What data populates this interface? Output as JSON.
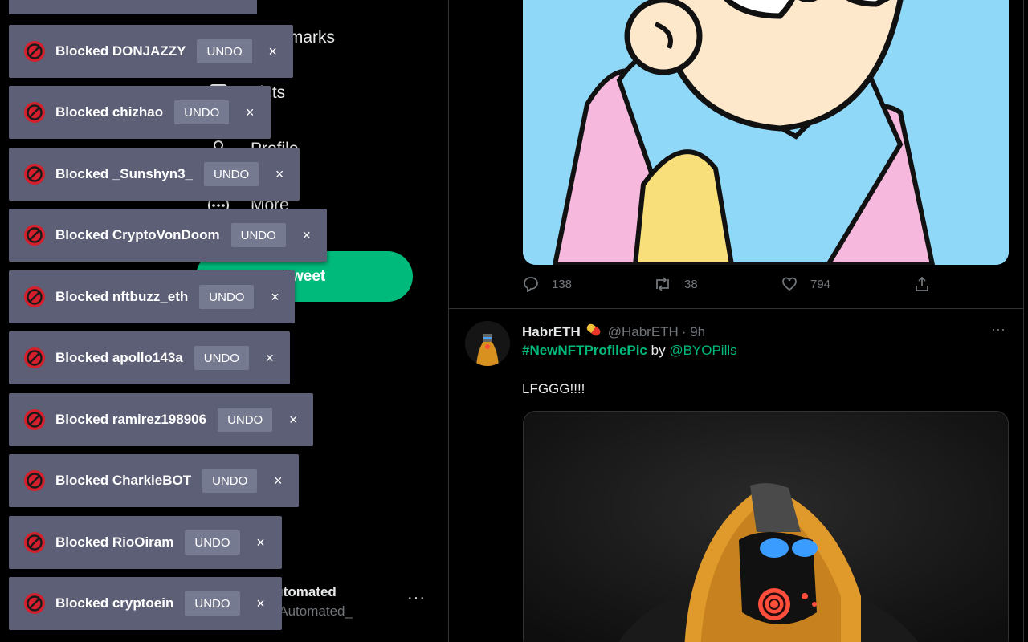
{
  "nav": {
    "bookmarks_label": "Bookmarks",
    "lists_label": "Lists",
    "profile_label": "Profile",
    "more_label": "More",
    "tweet_button_label": "Tweet"
  },
  "account": {
    "name": "Automated",
    "handle": "@Automated_",
    "more": "···"
  },
  "toasts": [
    {
      "message": "Blocked DONJAZZY",
      "undo": "UNDO",
      "close": "×"
    },
    {
      "message": "Blocked chizhao",
      "undo": "UNDO",
      "close": "×"
    },
    {
      "message": "Blocked _Sunshyn3_",
      "undo": "UNDO",
      "close": "×"
    },
    {
      "message": "Blocked CryptoVonDoom",
      "undo": "UNDO",
      "close": "×"
    },
    {
      "message": "Blocked nftbuzz_eth",
      "undo": "UNDO",
      "close": "×"
    },
    {
      "message": "Blocked apollo143a",
      "undo": "UNDO",
      "close": "×"
    },
    {
      "message": "Blocked ramirez198906",
      "undo": "UNDO",
      "close": "×"
    },
    {
      "message": "Blocked CharkieBOT",
      "undo": "UNDO",
      "close": "×"
    },
    {
      "message": "Blocked RioOiram",
      "undo": "UNDO",
      "close": "×"
    },
    {
      "message": "Blocked cryptoein",
      "undo": "UNDO",
      "close": "×"
    }
  ],
  "tweet1": {
    "replies": "138",
    "retweets": "38",
    "likes": "794"
  },
  "tweet2": {
    "name": "HabrETH",
    "handle": "@HabrETH",
    "time": "· 9h",
    "more": "···",
    "hashtag": "#NewNFTProfilePic",
    "by": "by",
    "mention": "@BYOPills",
    "body": "LFGGG!!!!"
  },
  "colors": {
    "accent": "#00ba7c",
    "toast_bg": "#5c5f75",
    "undo_bg": "#767a90",
    "block_badge": "#d61f2c"
  }
}
